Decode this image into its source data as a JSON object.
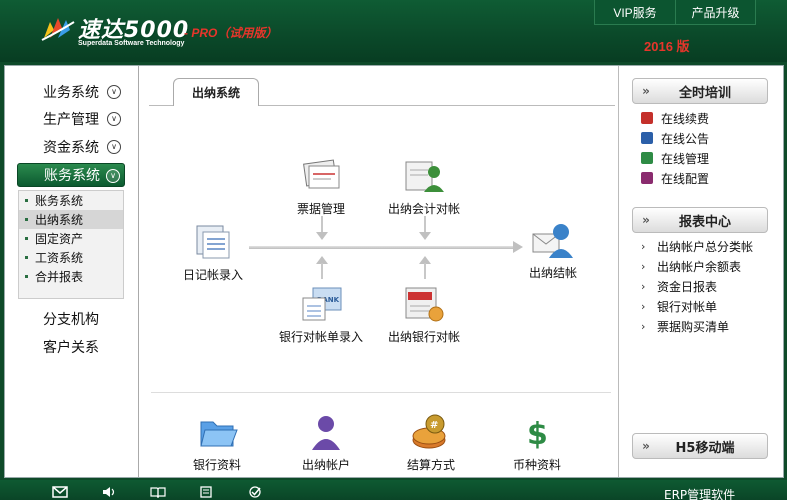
{
  "header": {
    "brand_name": "速达5000",
    "brand_sub": "Superdata Software Technology",
    "edition": "- PRO（试用版）",
    "year": "2016 版",
    "topnav": [
      {
        "label": "VIP服务"
      },
      {
        "label": "产品升级"
      }
    ]
  },
  "sidebar": {
    "items": [
      {
        "label": "业务系统"
      },
      {
        "label": "生产管理"
      },
      {
        "label": "资金系统"
      },
      {
        "label": "账务系统"
      }
    ],
    "submenu": [
      {
        "label": "账务系统"
      },
      {
        "label": "出纳系统"
      },
      {
        "label": "固定资产"
      },
      {
        "label": "工资系统"
      },
      {
        "label": "合并报表"
      }
    ],
    "plain": [
      {
        "label": "分支机构"
      },
      {
        "label": "客户关系"
      }
    ]
  },
  "content": {
    "tab": "出纳系统",
    "flow": {
      "journal": "日记帐录入",
      "bills": "票据管理",
      "cashier_reconcile": "出纳会计对帐",
      "bank_statement": "银行对帐单录入",
      "cashier_bank": "出纳银行对帐",
      "closing": "出纳结帐"
    },
    "bottom": [
      {
        "label": "银行资料"
      },
      {
        "label": "出纳帐户"
      },
      {
        "label": "结算方式"
      },
      {
        "label": "币种资料"
      }
    ]
  },
  "right": {
    "training": {
      "title": "全时培训",
      "items": [
        {
          "label": "在线续费"
        },
        {
          "label": "在线公告"
        },
        {
          "label": "在线管理"
        },
        {
          "label": "在线配置"
        }
      ]
    },
    "reports": {
      "title": "报表中心",
      "items": [
        {
          "label": "出纳帐户总分类帐"
        },
        {
          "label": "出纳帐户余额表"
        },
        {
          "label": "资金日报表"
        },
        {
          "label": "银行对帐单"
        },
        {
          "label": "票据购买清单"
        }
      ]
    },
    "mobile": {
      "title": "H5移动端"
    }
  },
  "footer": {
    "erp_text": "ERP管理软件"
  }
}
